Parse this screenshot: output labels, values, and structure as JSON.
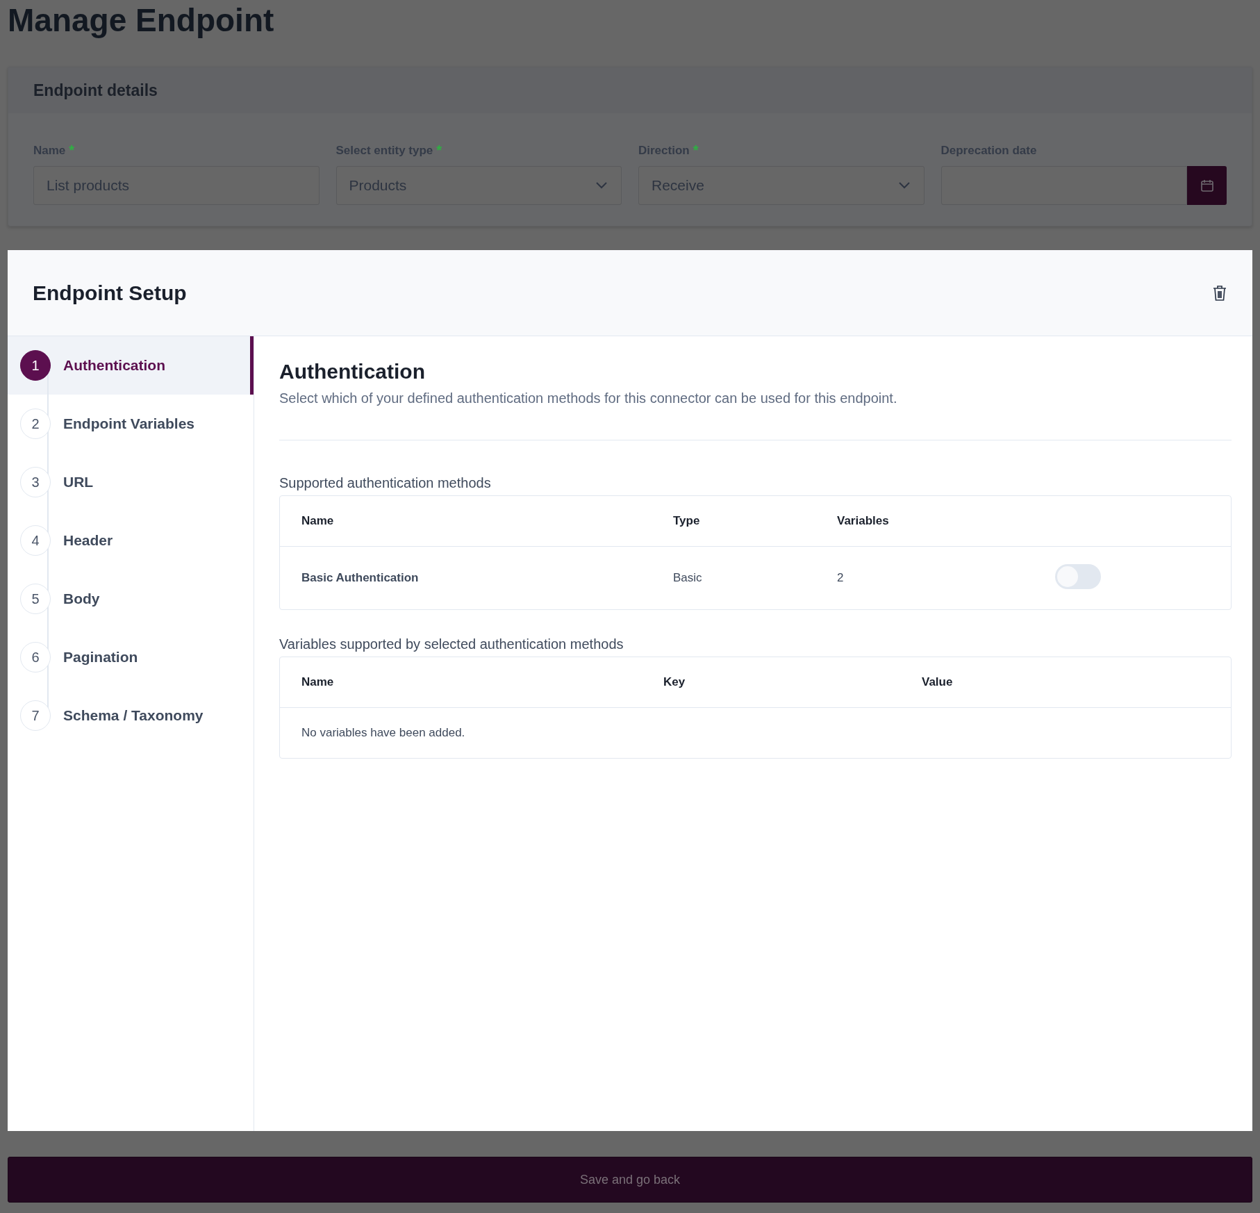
{
  "page_title": "Manage Endpoint",
  "details": {
    "heading": "Endpoint details",
    "fields": [
      {
        "label": "Name",
        "required_mark": "*",
        "kind": "text",
        "value": "List products"
      },
      {
        "label": "Select entity type",
        "required_mark": "*",
        "kind": "select",
        "value": "Products"
      },
      {
        "label": "Direction",
        "required_mark": "*",
        "kind": "select",
        "value": "Receive"
      },
      {
        "label": "Deprecation date",
        "kind": "date"
      }
    ]
  },
  "setup": {
    "title": "Endpoint Setup",
    "steps": [
      {
        "number": "1",
        "label": "Authentication",
        "selected": true
      },
      {
        "number": "2",
        "label": "Endpoint Variables",
        "selected": false
      },
      {
        "number": "3",
        "label": "URL",
        "selected": false
      },
      {
        "number": "4",
        "label": "Header",
        "selected": false
      },
      {
        "number": "5",
        "label": "Body",
        "selected": false
      },
      {
        "number": "6",
        "label": "Pagination",
        "selected": false
      },
      {
        "number": "7",
        "label": "Schema / Taxonomy",
        "selected": false
      }
    ],
    "section": {
      "title": "Authentication",
      "description": "Select which of your defined authentication methods for this connector can be used for this endpoint.",
      "methods": {
        "heading": "Supported authentication methods",
        "columns": [
          "Name",
          "Type",
          "Variables"
        ],
        "rows": [
          {
            "name": "Basic Authentication",
            "type": "Basic",
            "variables": "2",
            "on": false
          }
        ]
      },
      "variables": {
        "heading": "Variables supported by selected authentication methods",
        "columns": [
          "Name",
          "Key",
          "Value"
        ],
        "empty": "No variables have been added."
      }
    }
  },
  "save_button": "Save and go back"
}
